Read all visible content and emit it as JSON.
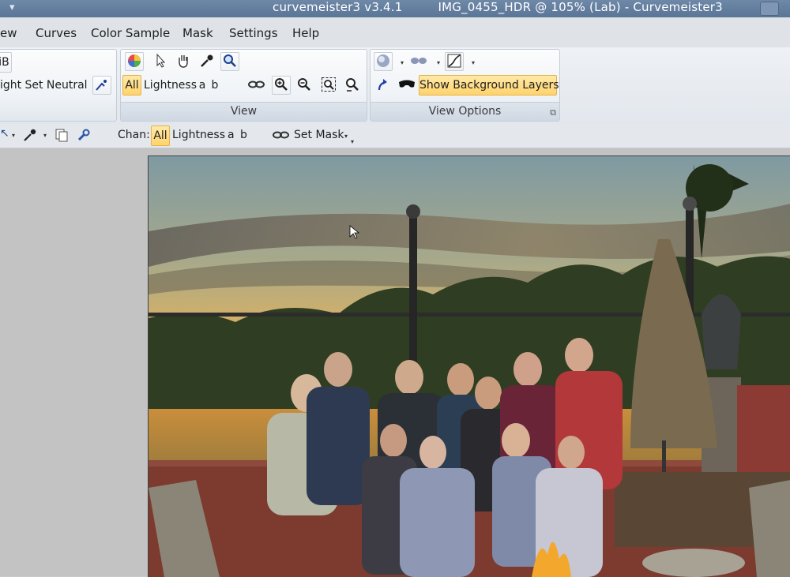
{
  "titlebar": {
    "app_version": "curvemeister3 v3.4.1",
    "document": "IMG_0455_HDR @ 105% (Lab) - Curvemeister3"
  },
  "menu": [
    "ew",
    "Curves",
    "Color Sample",
    "Mask",
    "Settings",
    "Help"
  ],
  "ribbon": {
    "left_group": {
      "partial_top": "iB",
      "light_label": "ight",
      "set_neutral": "Set Neutral"
    },
    "view_group": {
      "label": "View",
      "channels": [
        "All",
        "Lightness",
        "a",
        "b"
      ]
    },
    "view_options_group": {
      "label": "View Options",
      "show_background_layers": "Show Background Layers"
    }
  },
  "toolbar2": {
    "chan_label": "Chan:",
    "channels": [
      "All",
      "Lightness",
      "a",
      "b"
    ],
    "set_mask": "Set Mask"
  },
  "colors": {
    "highlight": "#ffd36b",
    "titlebar": "#5b7596",
    "ribbon_bg": "#e2e7ed"
  },
  "icons": {
    "color_wheel": "color-wheel-icon",
    "pointer": "pointer-icon",
    "hand": "hand-icon",
    "eyedropper": "eyedropper-icon",
    "zoom": "magnifier-icon"
  }
}
